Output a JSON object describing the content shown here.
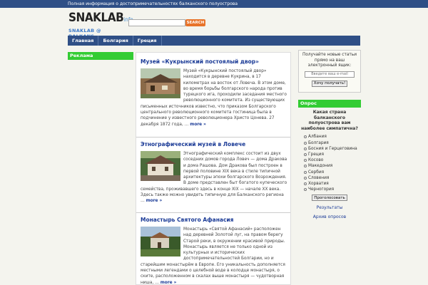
{
  "topbar": {
    "text": "Полная информация о достопримечательностях балканского полуострова"
  },
  "logo": {
    "main": "SNAKLAB",
    "info": "info",
    "sub": "SNAKLAB @ BALKANS"
  },
  "search": {
    "button": "SEARCH",
    "placeholder": ""
  },
  "nav": [
    {
      "label": "Главная"
    },
    {
      "label": "Болгария"
    },
    {
      "label": "Греция"
    }
  ],
  "left": {
    "ad_heading": "Реклама"
  },
  "posts": [
    {
      "title": "Музей «Кукрынский постоялый двор»",
      "text": "Музей «Кукрынский постоялый двор» находится в деревне Кукрина, в 17 километрах на восток от Ловеча. В этом доме, во время борьбы болгарского народа против турецкого ига, проходили заседания местного революционного комитета. Из существующих письменных источников известно, что приказом Болгарского центрального революционного комитета гостиница была в подчинение у известного революционера Христо Цонева. 27 декабря 1872 года, …",
      "more": "more »"
    },
    {
      "title": "Этнографический музей в Ловече",
      "text": "Этнографический комплекс состоит из двух соседних домов города Ловеч — дома Дракова и дома Рашова. Дом Дракова был построен в первой половине XIX века в стиле типичной архитектуры эпохи болгарского Возрождения. В доме представлен быт богатого купеческого семейства, проживавшего здесь в конце XIX — начале XX века. Здесь также можно увидеть типичную для Балканского региона …",
      "more": "more »"
    },
    {
      "title": "Монастырь Святого Афанасия",
      "text": "Монастырь «Святой Афанасий» расположен над деревней Золотой луг, на правом берегу Старой реки, в окружении красивой природы. Монастырь является не только одной из культурных и исторических достопримечательностей Болгарии, но и старейшим монастырём в Европе. Его уникальность дополняется местными легендами о целебной воде в колодце монастыря, о ските, расположенном в скалах выше монастыря — чудотворная ниша, …",
      "more": "more »"
    }
  ],
  "subscribe": {
    "text": "Получайте новые статьи прямо на ваш электронный ящик:",
    "placeholder": "Введите ваш e-mail",
    "button": "Хочу получать!"
  },
  "poll": {
    "heading": "Опрос",
    "question": "Какая страна балканского полуострова вам наиболее симпатична?",
    "options": [
      "Албания",
      "Болгария",
      "Босния и Герцеговина",
      "Греция",
      "Косово",
      "Македония",
      "Сербия",
      "Словения",
      "Хорватия",
      "Черногория"
    ],
    "vote": "Проголосовать",
    "results": "Результаты",
    "archive": "Архив опросов"
  },
  "colors": {
    "nav": "#2f4f86",
    "green": "#33cc33",
    "link": "#1a3a96",
    "search": "#e8732a"
  }
}
